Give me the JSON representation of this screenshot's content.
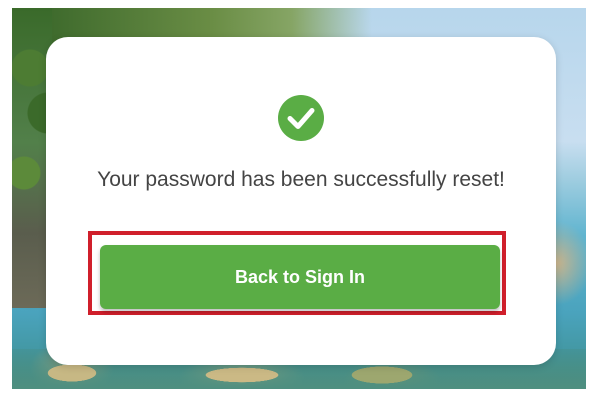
{
  "reset_card": {
    "success_icon": "check-circle-icon",
    "message": "Your password has been successfully reset!",
    "back_button_label": "Back to Sign In"
  },
  "colors": {
    "accent_green": "#5aad45",
    "highlight_red": "#d01f2b",
    "text": "#444444"
  }
}
